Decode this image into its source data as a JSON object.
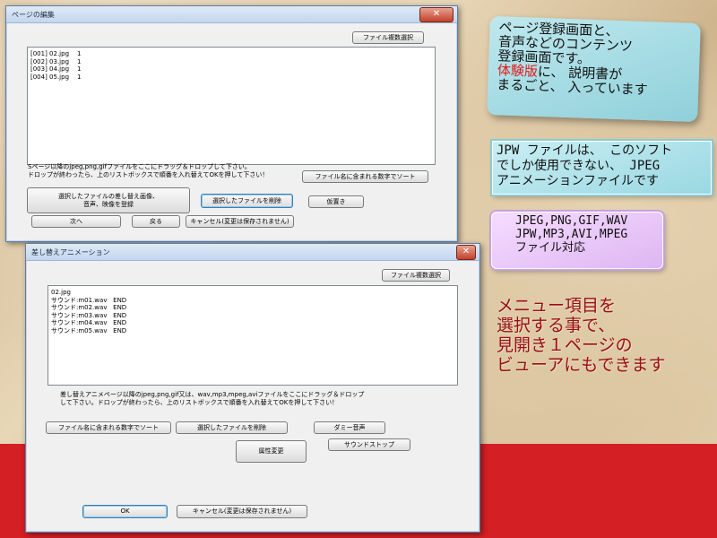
{
  "window1": {
    "title": "ページの編集",
    "file_multi_select": "ファイル複数選択",
    "list_items": [
      {
        "name": "[001] 02.jpg",
        "value": "1"
      },
      {
        "name": "[002] 03.jpg",
        "value": "1"
      },
      {
        "name": "[003] 04.jpg",
        "value": "1"
      },
      {
        "name": "[004] 05.jpg",
        "value": "1"
      }
    ],
    "instructions_line1": "Sページ以降のjpeg,png,gifファイルをここにドラッグ＆ドロップして下さい。",
    "instructions_line2": "ドロップが終わったら、上のリストボックスで順番を入れ替えてOKを押して下さい！",
    "sort_by_number": "ファイル名に含まれる数字でソート",
    "register_replacement": "選択したファイルの差し替え画像、\n音声、映像を登録",
    "delete_selected": "選択したファイルを削除",
    "temp_place": "仮置き",
    "next": "次へ",
    "back": "戻る",
    "cancel": "キャンセル(変更は保存されません)"
  },
  "window2": {
    "title": "差し替えアニメーション",
    "file_multi_select": "ファイル複数選択",
    "list_items": [
      "02.jpg",
      "サウンド:m01.wav   END",
      "サウンド:m02.wav   END",
      "サウンド:m03.wav   END",
      "サウンド:m04.wav   END",
      "サウンド:m05.wav   END"
    ],
    "instructions_line1": "差し替えアニメページ以降のjpeg,png,gif又は、wav,mp3,mpeg,aviファイルをここにドラッグ＆ドロップ",
    "instructions_line2": "して下さい。ドロップが終わったら、上のリストボックスで順番を入れ替えてOKを押して下さい！",
    "sort_by_number": "ファイル名に含まれる数字でソート",
    "delete_selected": "選択したファイルを削除",
    "dummy_sound": "ダミー音声",
    "sound_stop": "サウンドストップ",
    "attribute_change": "属性変更",
    "ok": "OK",
    "cancel": "キャンセル(変更は保存されません)"
  },
  "notes": {
    "note1_line1": "ページ登録画面と、",
    "note1_line2": "音声などのコンテンツ",
    "note1_line3": "登録画面です。",
    "note1_line4_red": "体験版",
    "note1_line4_rest": "に、 説明書が",
    "note1_line5": "まるごと、 入っています",
    "note2_line1": "JPW ファイルは、 このソフト",
    "note2_line2": "でしか使用できない、 JPEG",
    "note2_line3": "アニメーションファイルです",
    "note3_line1": "JPEG,PNG,GIF,WAV",
    "note3_line2": "JPW,MP3,AVI,MPEG",
    "note3_line3": "ファイル対応",
    "note4_line1": "メニュー項目を",
    "note4_line2": "選択する事で、",
    "note4_line3": "見開き１ページの",
    "note4_line4": "ビューアにもできます"
  },
  "colors": {
    "red_band": "#d41f24",
    "note_red_text": "#9a0f14",
    "highlight_red": "#e21a1a"
  }
}
